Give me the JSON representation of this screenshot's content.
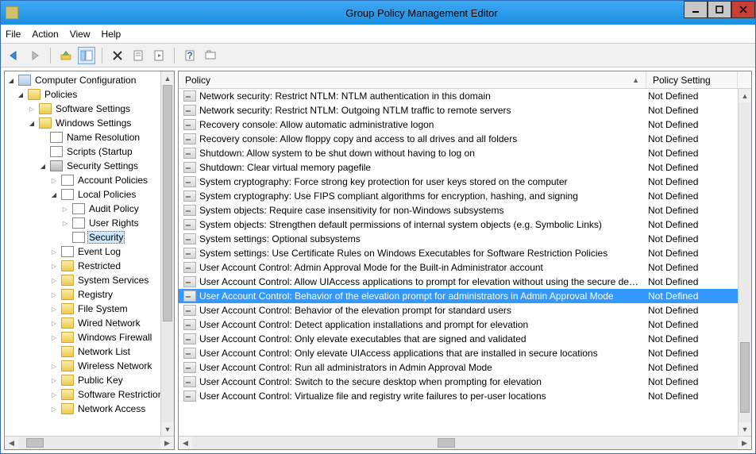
{
  "window": {
    "title": "Group Policy Management Editor"
  },
  "menu": {
    "file": "File",
    "action": "Action",
    "view": "View",
    "help": "Help"
  },
  "tree": {
    "root": "Computer Configuration",
    "policies": "Policies",
    "software": "Software Settings",
    "windows": "Windows Settings",
    "namers": "Name Resolution",
    "scripts": "Scripts (Startup",
    "secset": "Security Settings",
    "accountp": "Account Policies",
    "localpol": "Local Policies",
    "auditp": "Audit Policy",
    "userri": "User Rights",
    "security": "Security",
    "eventlog": "Event Log",
    "restricted": "Restricted",
    "systemse": "System Services",
    "registry": "Registry",
    "filesys": "File System",
    "wirednet": "Wired Network",
    "windowsf": "Windows Firewall",
    "networkl": "Network List",
    "wirelessn": "Wireless Network",
    "publickey": "Public Key",
    "softwarer": "Software Restriction",
    "networka": "Network Access"
  },
  "columns": {
    "policy": "Policy",
    "setting": "Policy Setting"
  },
  "settings": {
    "not_defined": "Not Defined"
  },
  "rows": [
    {
      "policy": "Network security: Restrict NTLM: NTLM authentication in this domain"
    },
    {
      "policy": "Network security: Restrict NTLM: Outgoing NTLM traffic to remote servers"
    },
    {
      "policy": "Recovery console: Allow automatic administrative logon"
    },
    {
      "policy": "Recovery console: Allow floppy copy and access to all drives and all folders"
    },
    {
      "policy": "Shutdown: Allow system to be shut down without having to log on"
    },
    {
      "policy": "Shutdown: Clear virtual memory pagefile"
    },
    {
      "policy": "System cryptography: Force strong key protection for user keys stored on the computer"
    },
    {
      "policy": "System cryptography: Use FIPS compliant algorithms for encryption, hashing, and signing"
    },
    {
      "policy": "System objects: Require case insensitivity for non-Windows subsystems"
    },
    {
      "policy": "System objects: Strengthen default permissions of internal system objects (e.g. Symbolic Links)"
    },
    {
      "policy": "System settings: Optional subsystems"
    },
    {
      "policy": "System settings: Use Certificate Rules on Windows Executables for Software Restriction Policies"
    },
    {
      "policy": "User Account Control: Admin Approval Mode for the Built-in Administrator account"
    },
    {
      "policy": "User Account Control: Allow UIAccess applications to prompt for elevation without using the secure deskt..."
    },
    {
      "policy": "User Account Control: Behavior of the elevation prompt for administrators in Admin Approval Mode",
      "selected": true
    },
    {
      "policy": "User Account Control: Behavior of the elevation prompt for standard users"
    },
    {
      "policy": "User Account Control: Detect application installations and prompt for elevation"
    },
    {
      "policy": "User Account Control: Only elevate executables that are signed and validated"
    },
    {
      "policy": "User Account Control: Only elevate UIAccess applications that are installed in secure locations"
    },
    {
      "policy": "User Account Control: Run all administrators in Admin Approval Mode"
    },
    {
      "policy": "User Account Control: Switch to the secure desktop when prompting for elevation"
    },
    {
      "policy": "User Account Control: Virtualize file and registry write failures to per-user locations"
    }
  ]
}
